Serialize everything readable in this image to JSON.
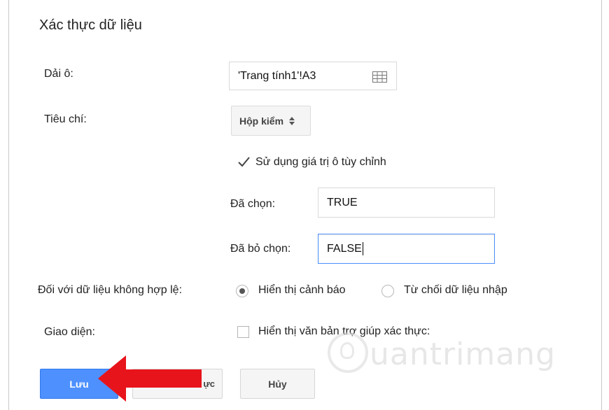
{
  "dialog": {
    "title": "Xác thực dữ liệu",
    "range": {
      "label": "Dải ô:",
      "value": "'Trang tính1'!A3",
      "icon": "grid-select-icon"
    },
    "criteria": {
      "label": "Tiêu chí:",
      "selected": "Hộp kiểm"
    },
    "custom_values": {
      "label": "Sử dụng giá trị ô tùy chỉnh",
      "checked": true
    },
    "checked_value": {
      "label": "Đã chọn:",
      "value": "TRUE"
    },
    "unchecked_value": {
      "label": "Đã bỏ chọn:",
      "value": "FALSE"
    },
    "invalid_data": {
      "label": "Đối với dữ liệu không hợp lệ:",
      "options": [
        {
          "label": "Hiển thị cảnh báo",
          "selected": true
        },
        {
          "label": "Từ chối dữ liệu nhập",
          "selected": false
        }
      ]
    },
    "appearance": {
      "label": "Giao diện:",
      "help_text_label": "Hiển thị văn bản trợ giúp xác thực:",
      "checked": false
    },
    "buttons": {
      "save": "Lưu",
      "remove_visible_fragment": "ực",
      "cancel": "Hủy"
    }
  },
  "overlay": {
    "arrow_color": "#e8141b",
    "watermark_text": "uantrimang"
  },
  "colors": {
    "primary": "#4d90fe",
    "focus_border": "#4d90fe"
  }
}
